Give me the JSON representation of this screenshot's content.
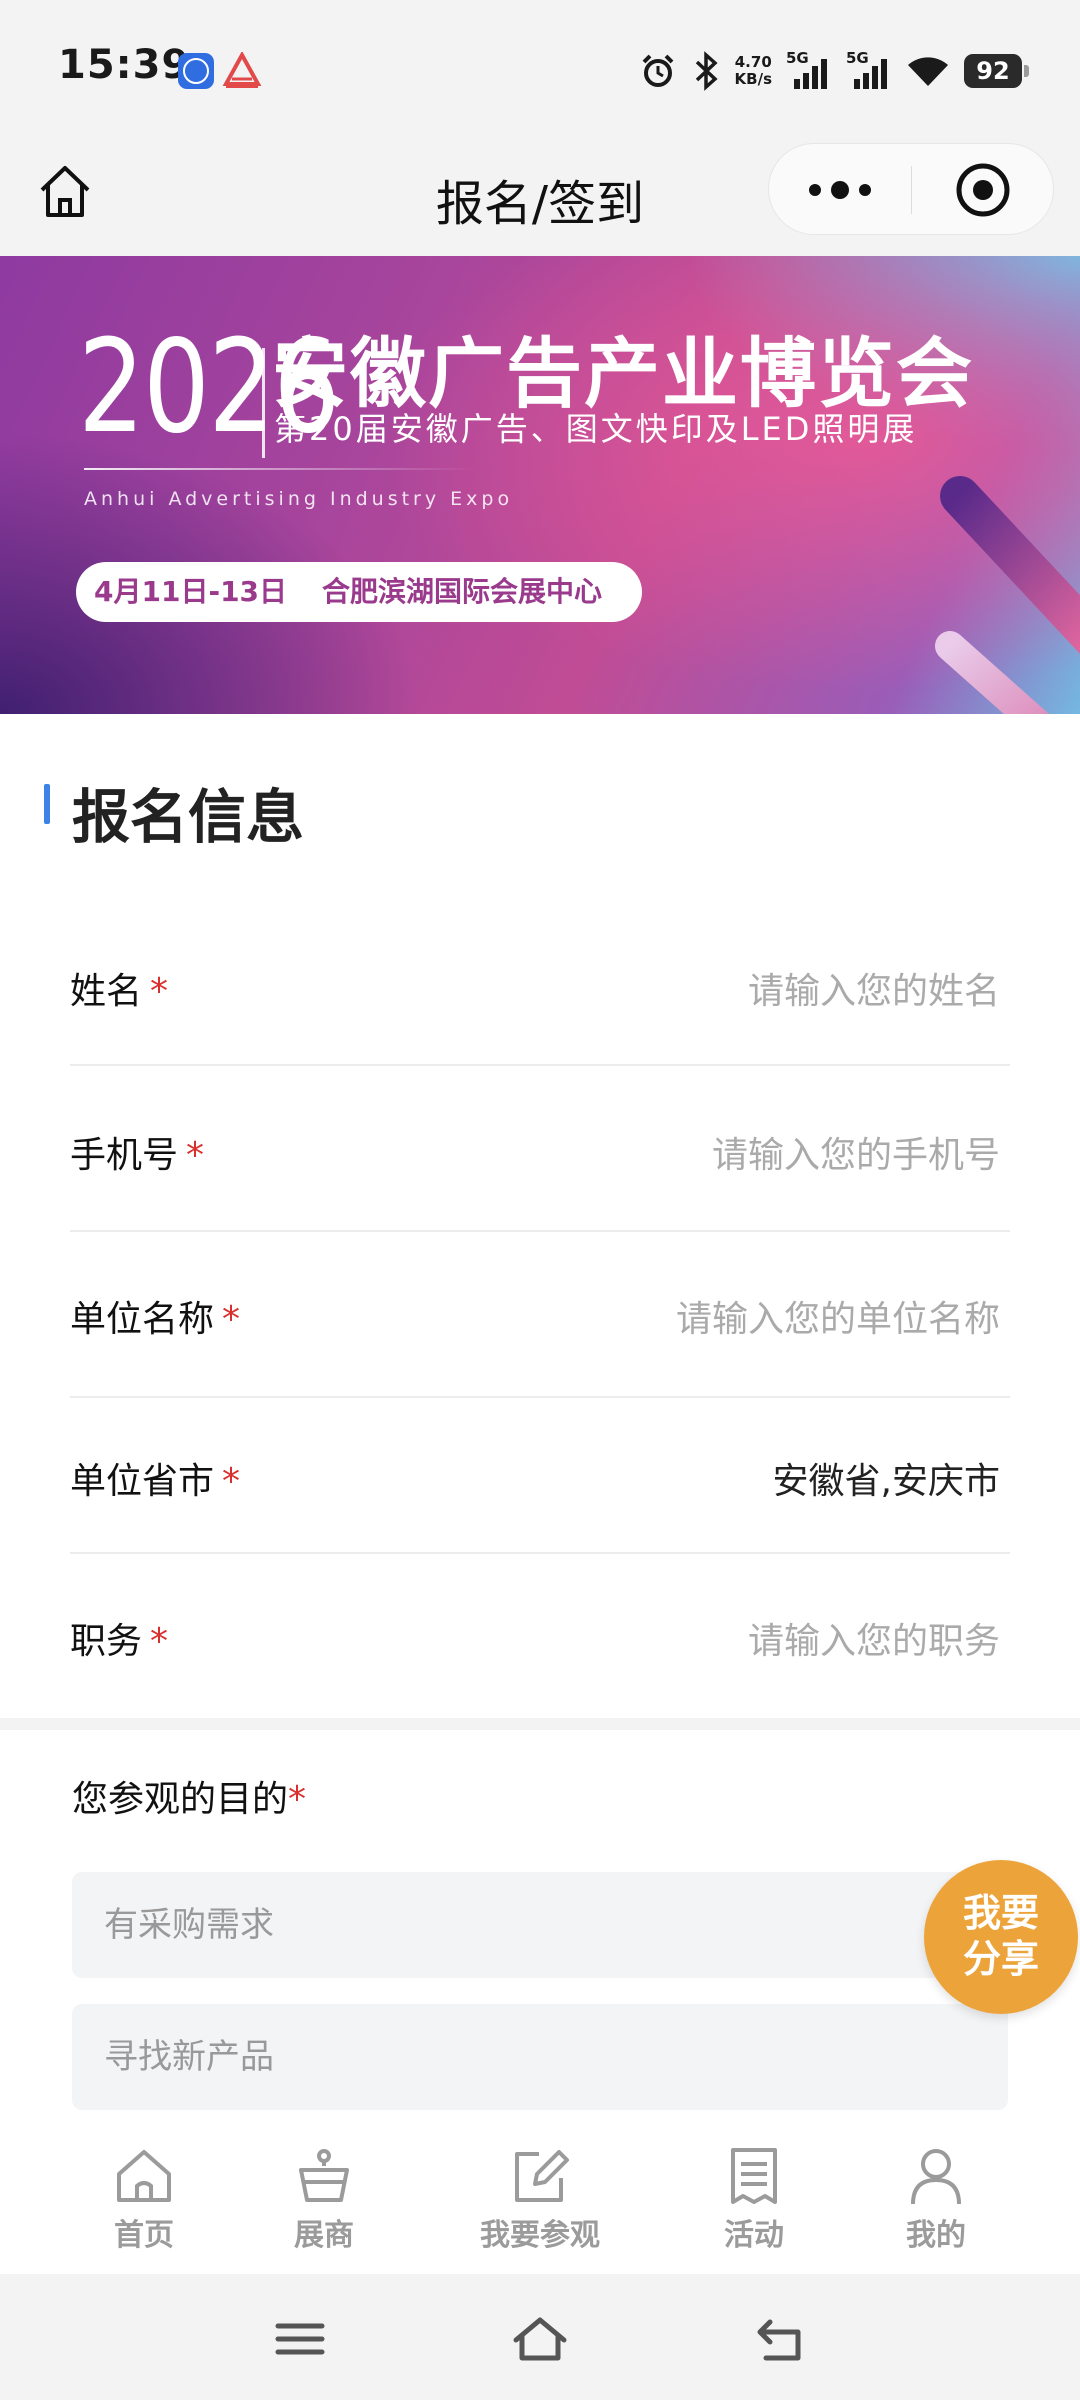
{
  "status_bar": {
    "time": "15:39",
    "net_speed_value": "4.70",
    "net_speed_unit": "KB/s",
    "sim1_type": "5G",
    "sim2_type": "5G",
    "battery": "92",
    "icons": [
      "k-app-icon",
      "red-app-icon",
      "alarm-icon",
      "bluetooth-icon",
      "signal-icon",
      "wifi-icon",
      "battery-icon"
    ]
  },
  "title_bar": {
    "title": "报名/签到"
  },
  "banner": {
    "year": "2026",
    "title": "安徽广告产业博览会",
    "subtitle": "第20届安徽广告、图文快印及LED照明展",
    "english": "Anhui Advertising Industry Expo",
    "date": "4月11日-13日",
    "venue": "合肥滨湖国际会展中心"
  },
  "form": {
    "section_title": "报名信息",
    "required_mark": "*",
    "fields": [
      {
        "label": "姓名",
        "value": "",
        "placeholder": "请输入您的姓名"
      },
      {
        "label": "手机号",
        "value": "",
        "placeholder": "请输入您的手机号"
      },
      {
        "label": "单位名称",
        "value": "",
        "placeholder": "请输入您的单位名称"
      },
      {
        "label": "单位省市",
        "value": "安徽省,安庆市",
        "placeholder": ""
      },
      {
        "label": "职务",
        "value": "",
        "placeholder": "请输入您的职务"
      }
    ]
  },
  "purpose": {
    "title": "您参观的目的",
    "options": [
      "有采购需求",
      "寻找新产品"
    ]
  },
  "share_button": {
    "line1": "我要",
    "line2": "分享",
    "color": "#eca43a"
  },
  "tabs": [
    {
      "label": "首页",
      "icon": "home-icon"
    },
    {
      "label": "展商",
      "icon": "exhibitor-icon"
    },
    {
      "label": "我要参观",
      "icon": "edit-icon"
    },
    {
      "label": "活动",
      "icon": "document-icon"
    },
    {
      "label": "我的",
      "icon": "user-icon"
    }
  ],
  "colors": {
    "accent": "#3d82e6",
    "required": "#d9302f",
    "banner_pill_text": "#9a3a8c"
  }
}
